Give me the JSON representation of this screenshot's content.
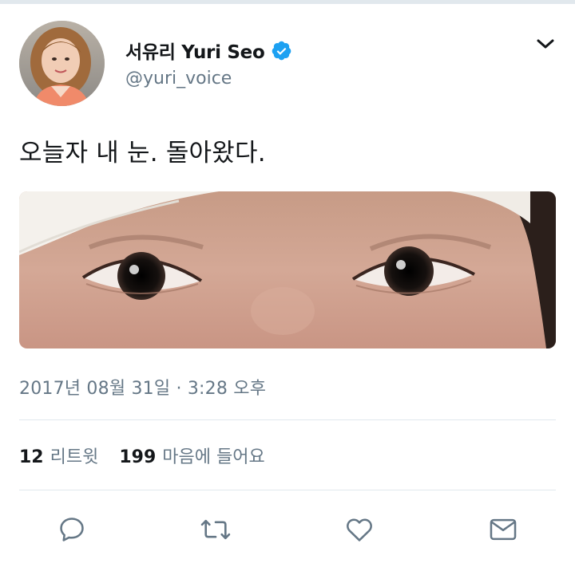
{
  "colors": {
    "text_primary": "#14171a",
    "text_secondary": "#657786",
    "verified_blue": "#1da1f2",
    "divider": "#e1e8ed"
  },
  "author": {
    "display_name": "서유리 Yuri Seo",
    "handle": "@yuri_voice",
    "verified": true,
    "avatar_icon": "profile-photo"
  },
  "tweet": {
    "text": "오늘자 내 눈. 돌아왔다.",
    "media_description_icon": "photo",
    "timestamp": "2017년 08월 31일 · 3:28 오후"
  },
  "stats": {
    "retweets_count": "12",
    "retweets_label": "리트윗",
    "likes_count": "199",
    "likes_label": "마음에 들어요"
  },
  "actions": [
    {
      "icon": "reply-icon"
    },
    {
      "icon": "retweet-icon"
    },
    {
      "icon": "like-icon"
    },
    {
      "icon": "direct-message-icon"
    }
  ],
  "menu": {
    "icon": "chevron-down-icon"
  }
}
